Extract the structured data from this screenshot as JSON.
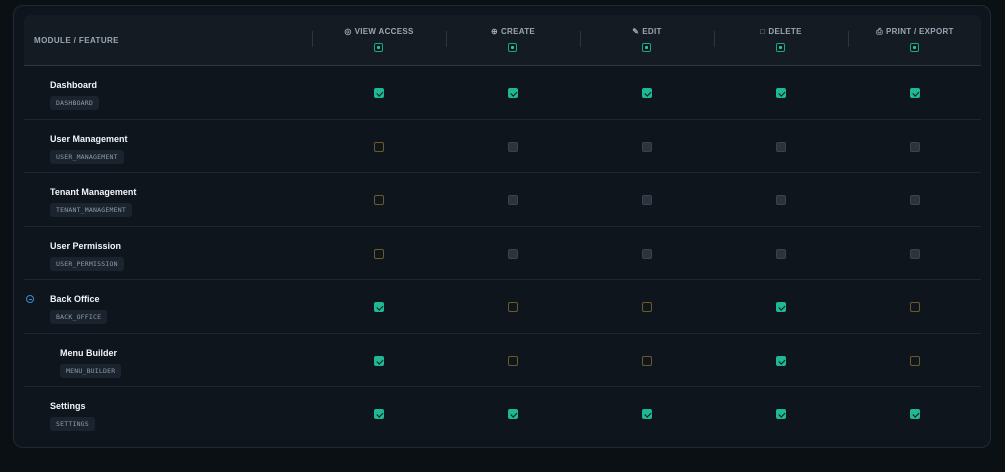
{
  "header": {
    "module_label": "MODULE / FEATURE",
    "columns": [
      {
        "key": "view",
        "label": "VIEW ACCESS",
        "icon": "eye-icon",
        "glyph": "◎"
      },
      {
        "key": "create",
        "label": "CREATE",
        "icon": "plus-circle-icon",
        "glyph": "⊕"
      },
      {
        "key": "edit",
        "label": "EDIT",
        "icon": "pencil-icon",
        "glyph": "✎"
      },
      {
        "key": "delete",
        "label": "DELETE",
        "icon": "trash-icon",
        "glyph": "□"
      },
      {
        "key": "print",
        "label": "PRINT / EXPORT",
        "icon": "printer-icon",
        "glyph": "⎙"
      }
    ]
  },
  "rows": [
    {
      "name": "Dashboard",
      "code": "DASHBOARD",
      "indent": 0,
      "collapsible": false,
      "perms": [
        "checked",
        "checked",
        "checked",
        "checked",
        "checked"
      ]
    },
    {
      "name": "User Management",
      "code": "USER_MANAGEMENT",
      "indent": 0,
      "collapsible": false,
      "perms": [
        "empty-gold",
        "empty-gray",
        "empty-gray",
        "empty-gray",
        "empty-gray"
      ]
    },
    {
      "name": "Tenant Management",
      "code": "TENANT_MANAGEMENT",
      "indent": 0,
      "collapsible": false,
      "perms": [
        "empty-gold",
        "empty-gray",
        "empty-gray",
        "empty-gray",
        "empty-gray"
      ]
    },
    {
      "name": "User Permission",
      "code": "USER_PERMISSION",
      "indent": 0,
      "collapsible": false,
      "perms": [
        "empty-gold",
        "empty-gray",
        "empty-gray",
        "empty-gray",
        "empty-gray"
      ]
    },
    {
      "name": "Back Office",
      "code": "BACK_OFFICE",
      "indent": 0,
      "collapsible": true,
      "perms": [
        "checked",
        "empty-gold",
        "empty-gold",
        "checked",
        "empty-gold"
      ]
    },
    {
      "name": "Menu Builder",
      "code": "MENU_BUILDER",
      "indent": 1,
      "collapsible": false,
      "perms": [
        "checked",
        "empty-gold",
        "empty-gold",
        "checked",
        "empty-gold"
      ]
    },
    {
      "name": "Settings",
      "code": "SETTINGS",
      "indent": 0,
      "collapsible": false,
      "perms": [
        "checked",
        "checked",
        "checked",
        "checked",
        "checked"
      ]
    }
  ],
  "colors": {
    "accent": "#1fb894",
    "background": "#0f151c",
    "collapse": "#3c8ad8"
  }
}
